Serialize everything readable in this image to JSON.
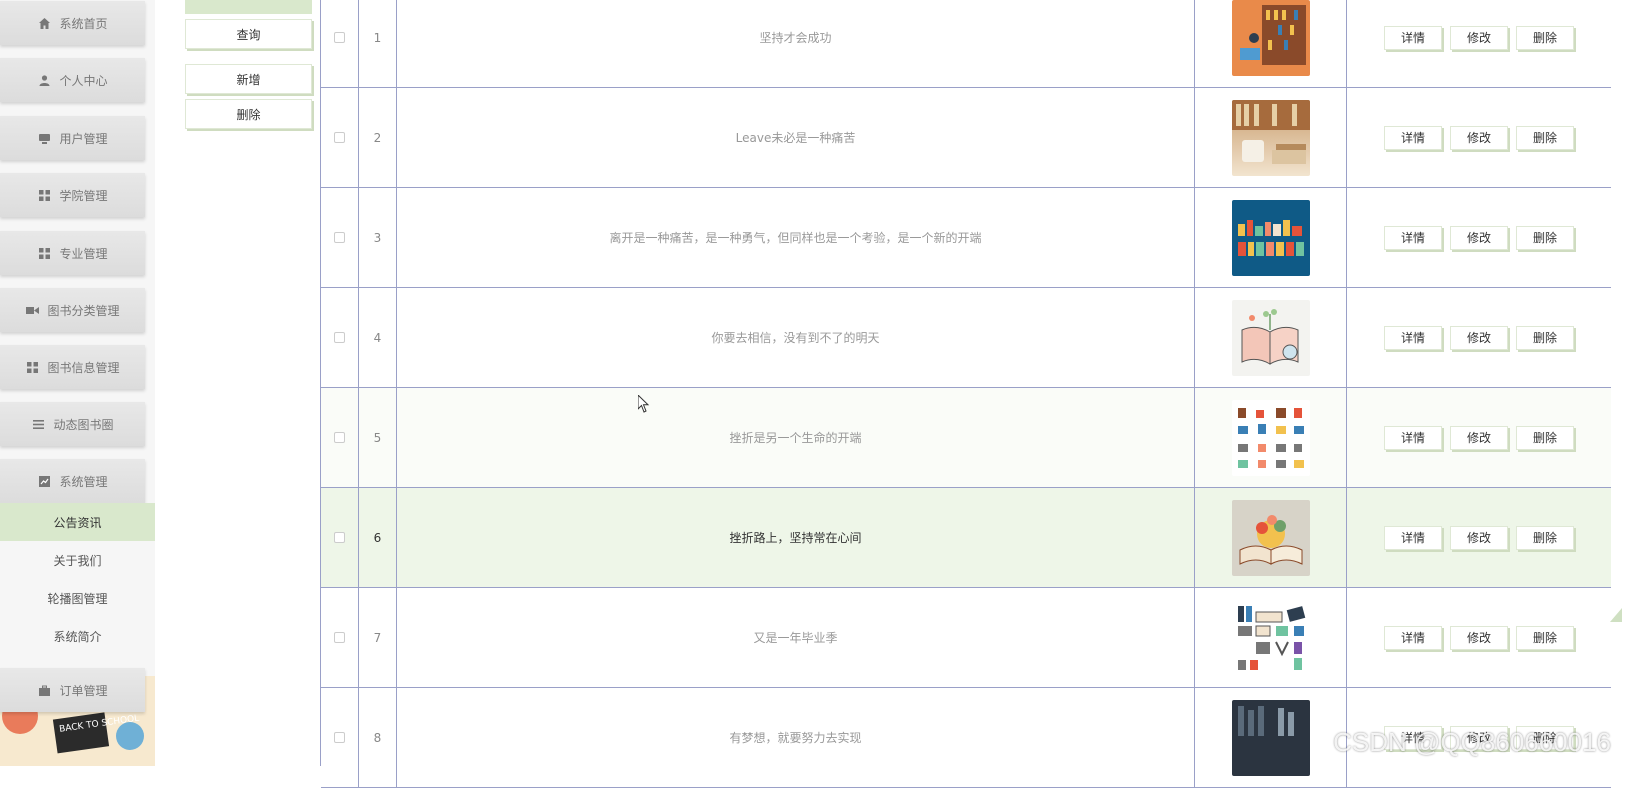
{
  "sidebar": {
    "items": [
      {
        "label": "系统首页",
        "icon": "home-icon"
      },
      {
        "label": "个人中心",
        "icon": "user-icon"
      },
      {
        "label": "用户管理",
        "icon": "users-icon"
      },
      {
        "label": "学院管理",
        "icon": "grid-icon"
      },
      {
        "label": "专业管理",
        "icon": "grid-icon"
      },
      {
        "label": "图书分类管理",
        "icon": "video-icon"
      },
      {
        "label": "图书信息管理",
        "icon": "grid-icon"
      },
      {
        "label": "动态图书圈",
        "icon": "list-icon"
      },
      {
        "label": "系统管理",
        "icon": "chart-icon"
      }
    ],
    "submenu": [
      {
        "label": "公告资讯",
        "active": true
      },
      {
        "label": "关于我们",
        "active": false
      },
      {
        "label": "轮播图管理",
        "active": false
      },
      {
        "label": "系统简介",
        "active": false
      }
    ],
    "order_item": {
      "label": "订单管理",
      "icon": "briefcase-icon"
    },
    "art_text": "BACK TO SCHOOL"
  },
  "actions": {
    "query": "查询",
    "add": "新增",
    "delete": "删除"
  },
  "table": {
    "rows": [
      {
        "index": "1",
        "title": "坚持才会成功",
        "image": "bookshelf-illustration"
      },
      {
        "index": "2",
        "title": "Leave未必是一种痛苦",
        "image": "books-and-cup-photo"
      },
      {
        "index": "3",
        "title": "离开是一种痛苦，是一种勇气，但同样也是一个考验，是一个新的开端",
        "image": "library-letters-image"
      },
      {
        "index": "4",
        "title": "你要去相信，没有到不了的明天",
        "image": "open-book-plant-illustration"
      },
      {
        "index": "5",
        "title": "挫折是另一个生命的开端",
        "image": "book-icons-grid"
      },
      {
        "index": "6",
        "title": "挫折路上，坚持常在心间",
        "image": "world-book-day-illustration"
      },
      {
        "index": "7",
        "title": "又是一年毕业季",
        "image": "books-collection-illustration"
      },
      {
        "index": "8",
        "title": "有梦想，就要努力去实现",
        "image": "dark-bookshelf-photo"
      }
    ],
    "ops": {
      "detail": "详情",
      "edit": "修改",
      "delete": "删除"
    }
  },
  "watermark": "CSDN @QQ860660016",
  "colors": {
    "accent_green": "#d9e8cc",
    "table_border": "#9aa0c8"
  }
}
